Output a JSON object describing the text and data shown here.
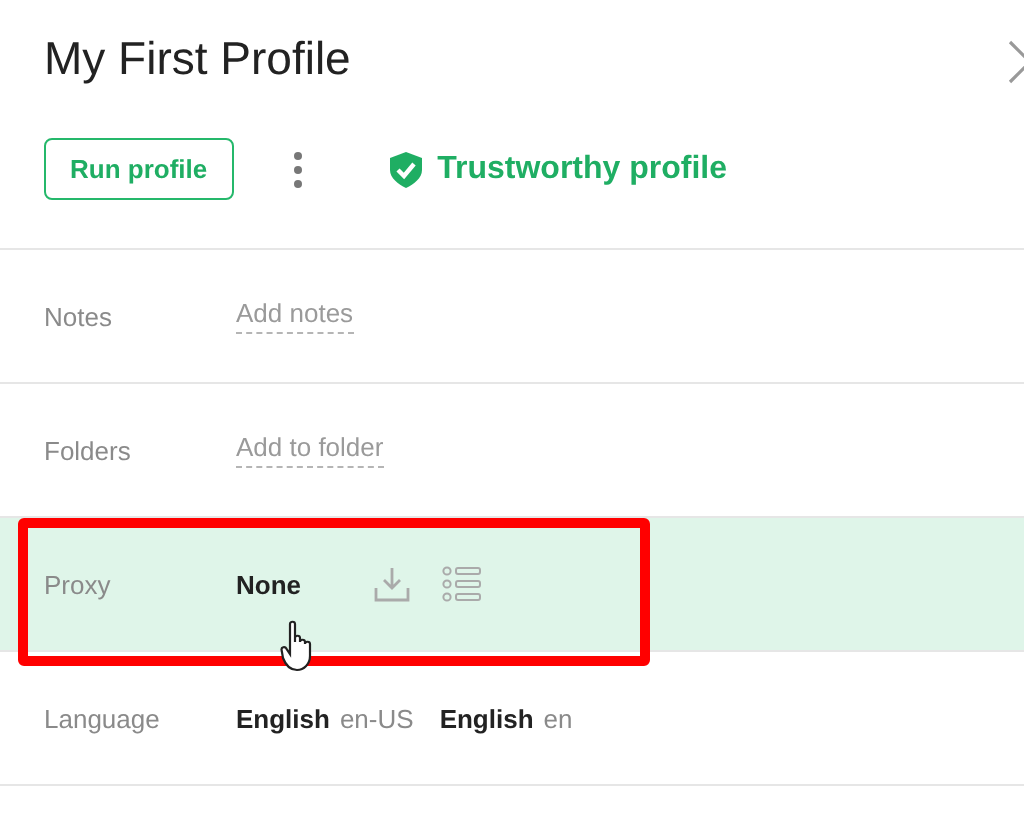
{
  "title": "My First Profile",
  "actions": {
    "run_button": "Run profile",
    "status": "Trustworthy profile"
  },
  "rows": [
    {
      "label": "Notes",
      "kind": "link",
      "text": "Add notes",
      "highlighted": false
    },
    {
      "label": "Folders",
      "kind": "link",
      "text": "Add to folder",
      "highlighted": false
    },
    {
      "label": "Proxy",
      "kind": "proxy",
      "text": "None",
      "highlighted": true
    },
    {
      "label": "Language",
      "kind": "languages",
      "languages": [
        {
          "name": "English",
          "code": "en-US"
        },
        {
          "name": "English",
          "code": "en"
        }
      ],
      "highlighted": false
    }
  ]
}
